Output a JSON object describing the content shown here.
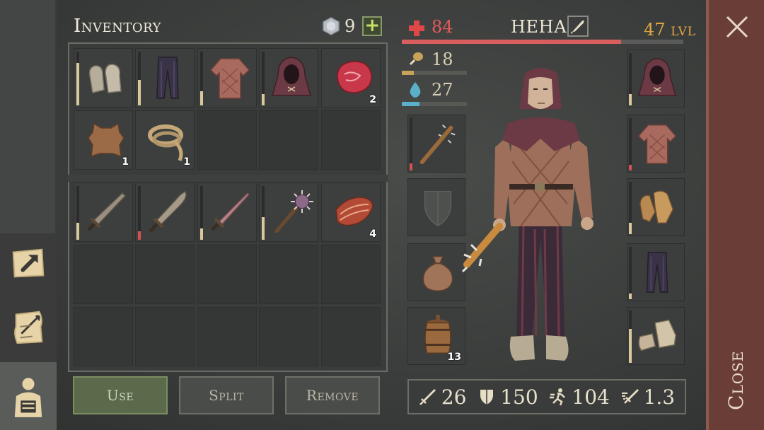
{
  "inventory": {
    "title": "Inventory",
    "coins": "9",
    "add_label": "+",
    "rows": [
      [
        {
          "icon": "mittens-icon",
          "durability": 0.75
        },
        {
          "icon": "pants-icon",
          "durability": 0.45
        },
        {
          "icon": "padded-shirt-icon",
          "durability": 0.25
        },
        {
          "icon": "hood-icon",
          "durability": 0.2
        },
        {
          "icon": "raw-meat-icon",
          "qty": "2"
        }
      ],
      [
        {
          "icon": "leather-hide-icon",
          "qty": "1"
        },
        {
          "icon": "rope-icon",
          "qty": "1"
        },
        {
          "icon": "",
          "empty": true
        },
        {
          "icon": "",
          "empty": true
        },
        {
          "icon": "",
          "empty": true
        }
      ],
      [
        {
          "icon": "sword-icon",
          "durability": 0.3
        },
        {
          "icon": "machete-icon",
          "durability": 0.15,
          "low": true
        },
        {
          "icon": "longsword-icon",
          "durability": 0.2
        },
        {
          "icon": "mace-icon",
          "durability": 0.4
        },
        {
          "icon": "bacon-icon",
          "qty": "4"
        }
      ]
    ],
    "buttons": {
      "use": "Use",
      "split": "Split",
      "remove": "Remove"
    }
  },
  "character": {
    "health": "84",
    "health_fraction": 0.78,
    "name": "НЕНА",
    "level": "47",
    "level_unit": "LVL",
    "food": "18",
    "food_fraction": 0.18,
    "water": "27",
    "water_fraction": 0.27
  },
  "equipment_left": [
    {
      "icon": "spiked-club-icon",
      "durability": 0.12,
      "low": true
    },
    {
      "icon": "shield-silhouette-icon"
    },
    {
      "icon": "sack-icon"
    },
    {
      "icon": "barrel-icon",
      "qty": "13"
    }
  ],
  "equipment_right": [
    {
      "icon": "hood-icon",
      "durability": 0.2
    },
    {
      "icon": "padded-shirt-icon",
      "durability": 0.1,
      "low": true
    },
    {
      "icon": "leather-gloves-icon",
      "durability": 0.2
    },
    {
      "icon": "pants-icon",
      "durability": 0.1
    },
    {
      "icon": "boots-icon",
      "durability": 0.6
    }
  ],
  "stats": {
    "attack": "26",
    "defense": "150",
    "speed": "104",
    "attack_speed": "1.3"
  },
  "close_label": "Close",
  "colors": {
    "health": "#d95e5e",
    "level": "#e1a644",
    "food": "#c9a25a",
    "water": "#5ab0c8"
  }
}
